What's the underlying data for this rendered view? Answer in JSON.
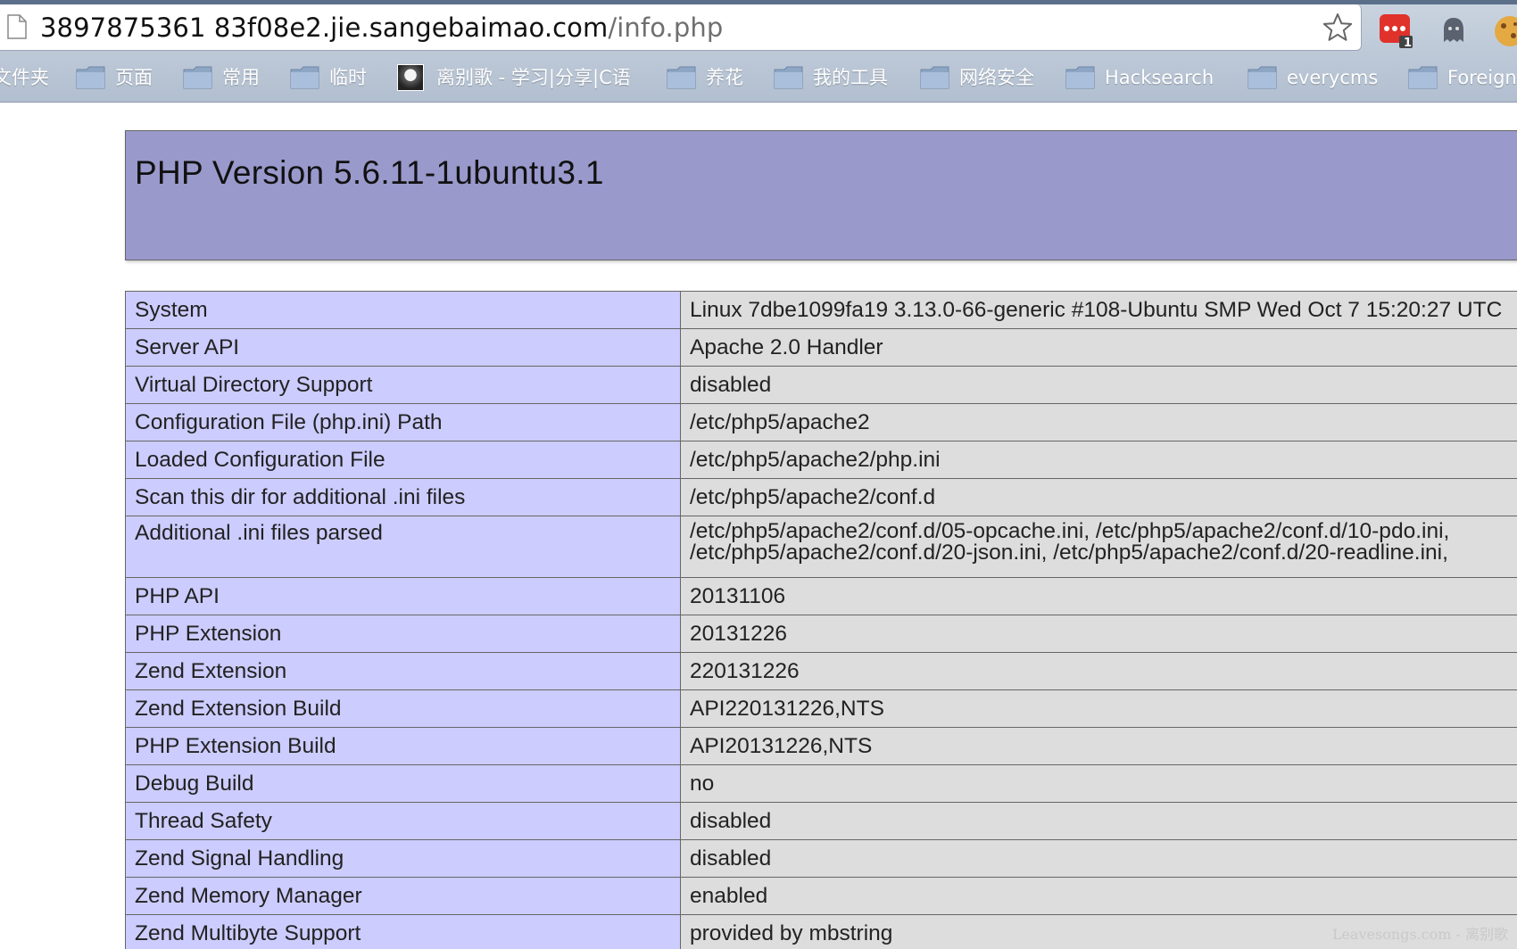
{
  "browser": {
    "url_host": "3897875361 83f08e2.jie.sangebaimao.com",
    "url_path": "/info.php",
    "bookmarks": [
      {
        "label": "文件夹",
        "icon": "folder-icon"
      },
      {
        "label": "页面",
        "icon": "folder-icon"
      },
      {
        "label": "常用",
        "icon": "folder-icon"
      },
      {
        "label": "临时",
        "icon": "folder-icon"
      },
      {
        "label": "离别歌 - 学习|分享|C语",
        "icon": "avatar-icon"
      },
      {
        "label": "养花",
        "icon": "folder-icon"
      },
      {
        "label": "我的工具",
        "icon": "folder-icon"
      },
      {
        "label": "网络安全",
        "icon": "folder-icon"
      },
      {
        "label": "Hacksearch",
        "icon": "folder-icon"
      },
      {
        "label": "everycms",
        "icon": "folder-icon"
      },
      {
        "label": "Foreign",
        "icon": "folder-icon"
      }
    ],
    "extension_badge": "1",
    "colors": {
      "accent_red": "#e0312b",
      "chrome": "#b8c4d4"
    }
  },
  "phpinfo": {
    "title": "PHP Version 5.6.11-1ubuntu3.1",
    "rows": [
      {
        "name": "System",
        "value": "Linux 7dbe1099fa19 3.13.0-66-generic #108-Ubuntu SMP Wed Oct 7 15:20:27 UTC"
      },
      {
        "name": "Server API",
        "value": "Apache 2.0 Handler"
      },
      {
        "name": "Virtual Directory Support",
        "value": "disabled"
      },
      {
        "name": "Configuration File (php.ini) Path",
        "value": "/etc/php5/apache2"
      },
      {
        "name": "Loaded Configuration File",
        "value": "/etc/php5/apache2/php.ini"
      },
      {
        "name": "Scan this dir for additional .ini files",
        "value": "/etc/php5/apache2/conf.d"
      },
      {
        "name": "Additional .ini files parsed",
        "value": "/etc/php5/apache2/conf.d/05-opcache.ini, /etc/php5/apache2/conf.d/10-pdo.ini,",
        "value2": "/etc/php5/apache2/conf.d/20-json.ini, /etc/php5/apache2/conf.d/20-readline.ini,"
      },
      {
        "name": "PHP API",
        "value": "20131106"
      },
      {
        "name": "PHP Extension",
        "value": "20131226"
      },
      {
        "name": "Zend Extension",
        "value": "220131226"
      },
      {
        "name": "Zend Extension Build",
        "value": "API220131226,NTS"
      },
      {
        "name": "PHP Extension Build",
        "value": "API20131226,NTS"
      },
      {
        "name": "Debug Build",
        "value": "no"
      },
      {
        "name": "Thread Safety",
        "value": "disabled"
      },
      {
        "name": "Zend Signal Handling",
        "value": "disabled"
      },
      {
        "name": "Zend Memory Manager",
        "value": "enabled"
      },
      {
        "name": "Zend Multibyte Support",
        "value": "provided by mbstring"
      }
    ],
    "watermark": "Leavesongs.com - 离别歌",
    "colors": {
      "header_bg": "#9999cc",
      "key_bg": "#ccccff",
      "value_bg": "#dddddd"
    }
  }
}
